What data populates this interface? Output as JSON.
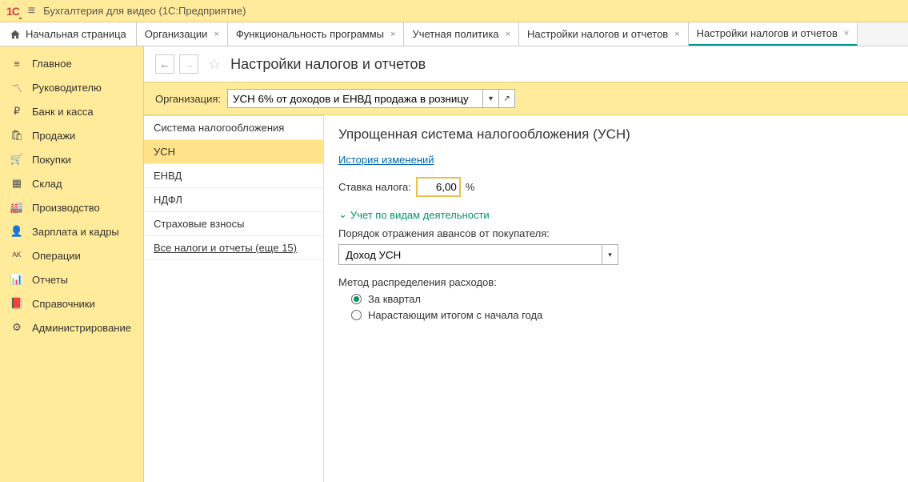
{
  "app": {
    "title": "Бухгалтерия для видео  (1С:Предприятие)"
  },
  "tabs": {
    "home": "Начальная страница",
    "items": [
      {
        "label": "Организации"
      },
      {
        "label": "Функциональность программы"
      },
      {
        "label": "Учетная политика"
      },
      {
        "label": "Настройки налогов и отчетов"
      },
      {
        "label": "Настройки налогов и отчетов",
        "active": true
      }
    ]
  },
  "sidebar": {
    "items": [
      "Главное",
      "Руководителю",
      "Банк и касса",
      "Продажи",
      "Покупки",
      "Склад",
      "Производство",
      "Зарплата и кадры",
      "Операции",
      "Отчеты",
      "Справочники",
      "Администрирование"
    ]
  },
  "page": {
    "title": "Настройки налогов и отчетов"
  },
  "org": {
    "label": "Организация:",
    "value": "УСН 6% от доходов и ЕНВД продажа в розницу"
  },
  "nav_panel": {
    "items": [
      "Система налогообложения",
      "УСН",
      "ЕНВД",
      "НДФЛ",
      "Страховые взносы"
    ],
    "all_link": "Все налоги и отчеты (еще 15)"
  },
  "form": {
    "title": "Упрощенная система налогообложения (УСН)",
    "history_link": "История изменений",
    "rate_label": "Ставка налога:",
    "rate_value": "6,00",
    "rate_unit": "%",
    "expand_label": "Учет по видам деятельности",
    "advance_label": "Порядок отражения авансов от покупателя:",
    "advance_value": "Доход УСН",
    "method_label": "Метод распределения расходов:",
    "radio1": "За квартал",
    "radio2": "Нарастающим итогом с начала года"
  }
}
